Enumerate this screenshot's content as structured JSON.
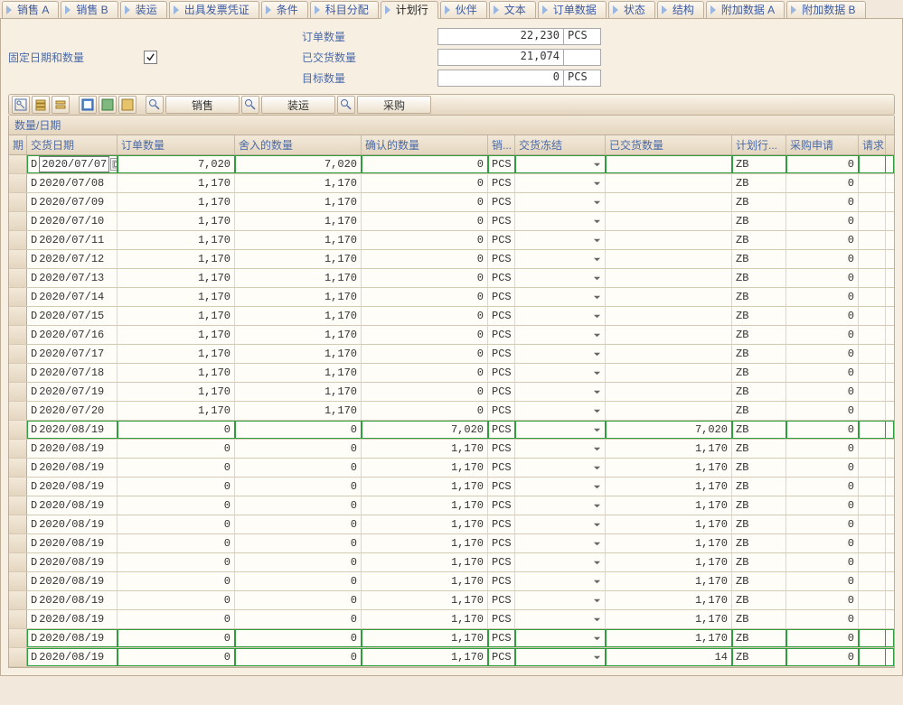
{
  "tabs": [
    "销售 A",
    "销售 B",
    "装运",
    "出具发票凭证",
    "条件",
    "科目分配",
    "计划行",
    "伙伴",
    "文本",
    "订单数据",
    "状态",
    "结构",
    "附加数据 A",
    "附加数据 B"
  ],
  "active_tab_index": 6,
  "form": {
    "fixed_date_qty_label": "固定日期和数量",
    "fixed_date_qty_checked": true,
    "rows": [
      {
        "label": "订单数量",
        "value": "22,230",
        "unit": "PCS"
      },
      {
        "label": "已交货数量",
        "value": "21,074",
        "unit": ""
      },
      {
        "label": "目标数量",
        "value": "0",
        "unit": "PCS"
      }
    ]
  },
  "toolbar": {
    "btn_sales": "销售",
    "btn_shipping": "装运",
    "btn_purchase": "采购"
  },
  "table": {
    "title": "数量/日期",
    "columns": [
      "期",
      "交货日期",
      "订单数量",
      "舍入的数量",
      "确认的数量",
      "销...",
      "交货冻结",
      "已交货数量",
      "计划行...",
      "采购申请",
      "请求..."
    ],
    "rows": [
      {
        "p": "D",
        "date": "2020/07/07",
        "oq": "7,020",
        "rq": "7,020",
        "cq": "0",
        "u": "PCS",
        "dq": "",
        "sl": "ZB",
        "pr": "0",
        "hi": true,
        "sel": true
      },
      {
        "p": "D",
        "date": "2020/07/08",
        "oq": "1,170",
        "rq": "1,170",
        "cq": "0",
        "u": "PCS",
        "dq": "",
        "sl": "ZB",
        "pr": "0"
      },
      {
        "p": "D",
        "date": "2020/07/09",
        "oq": "1,170",
        "rq": "1,170",
        "cq": "0",
        "u": "PCS",
        "dq": "",
        "sl": "ZB",
        "pr": "0"
      },
      {
        "p": "D",
        "date": "2020/07/10",
        "oq": "1,170",
        "rq": "1,170",
        "cq": "0",
        "u": "PCS",
        "dq": "",
        "sl": "ZB",
        "pr": "0"
      },
      {
        "p": "D",
        "date": "2020/07/11",
        "oq": "1,170",
        "rq": "1,170",
        "cq": "0",
        "u": "PCS",
        "dq": "",
        "sl": "ZB",
        "pr": "0"
      },
      {
        "p": "D",
        "date": "2020/07/12",
        "oq": "1,170",
        "rq": "1,170",
        "cq": "0",
        "u": "PCS",
        "dq": "",
        "sl": "ZB",
        "pr": "0"
      },
      {
        "p": "D",
        "date": "2020/07/13",
        "oq": "1,170",
        "rq": "1,170",
        "cq": "0",
        "u": "PCS",
        "dq": "",
        "sl": "ZB",
        "pr": "0"
      },
      {
        "p": "D",
        "date": "2020/07/14",
        "oq": "1,170",
        "rq": "1,170",
        "cq": "0",
        "u": "PCS",
        "dq": "",
        "sl": "ZB",
        "pr": "0"
      },
      {
        "p": "D",
        "date": "2020/07/15",
        "oq": "1,170",
        "rq": "1,170",
        "cq": "0",
        "u": "PCS",
        "dq": "",
        "sl": "ZB",
        "pr": "0"
      },
      {
        "p": "D",
        "date": "2020/07/16",
        "oq": "1,170",
        "rq": "1,170",
        "cq": "0",
        "u": "PCS",
        "dq": "",
        "sl": "ZB",
        "pr": "0"
      },
      {
        "p": "D",
        "date": "2020/07/17",
        "oq": "1,170",
        "rq": "1,170",
        "cq": "0",
        "u": "PCS",
        "dq": "",
        "sl": "ZB",
        "pr": "0"
      },
      {
        "p": "D",
        "date": "2020/07/18",
        "oq": "1,170",
        "rq": "1,170",
        "cq": "0",
        "u": "PCS",
        "dq": "",
        "sl": "ZB",
        "pr": "0"
      },
      {
        "p": "D",
        "date": "2020/07/19",
        "oq": "1,170",
        "rq": "1,170",
        "cq": "0",
        "u": "PCS",
        "dq": "",
        "sl": "ZB",
        "pr": "0"
      },
      {
        "p": "D",
        "date": "2020/07/20",
        "oq": "1,170",
        "rq": "1,170",
        "cq": "0",
        "u": "PCS",
        "dq": "",
        "sl": "ZB",
        "pr": "0"
      },
      {
        "p": "D",
        "date": "2020/08/19",
        "oq": "0",
        "rq": "0",
        "cq": "7,020",
        "u": "PCS",
        "dq": "7,020",
        "sl": "ZB",
        "pr": "0",
        "hi": true
      },
      {
        "p": "D",
        "date": "2020/08/19",
        "oq": "0",
        "rq": "0",
        "cq": "1,170",
        "u": "PCS",
        "dq": "1,170",
        "sl": "ZB",
        "pr": "0"
      },
      {
        "p": "D",
        "date": "2020/08/19",
        "oq": "0",
        "rq": "0",
        "cq": "1,170",
        "u": "PCS",
        "dq": "1,170",
        "sl": "ZB",
        "pr": "0"
      },
      {
        "p": "D",
        "date": "2020/08/19",
        "oq": "0",
        "rq": "0",
        "cq": "1,170",
        "u": "PCS",
        "dq": "1,170",
        "sl": "ZB",
        "pr": "0"
      },
      {
        "p": "D",
        "date": "2020/08/19",
        "oq": "0",
        "rq": "0",
        "cq": "1,170",
        "u": "PCS",
        "dq": "1,170",
        "sl": "ZB",
        "pr": "0"
      },
      {
        "p": "D",
        "date": "2020/08/19",
        "oq": "0",
        "rq": "0",
        "cq": "1,170",
        "u": "PCS",
        "dq": "1,170",
        "sl": "ZB",
        "pr": "0"
      },
      {
        "p": "D",
        "date": "2020/08/19",
        "oq": "0",
        "rq": "0",
        "cq": "1,170",
        "u": "PCS",
        "dq": "1,170",
        "sl": "ZB",
        "pr": "0"
      },
      {
        "p": "D",
        "date": "2020/08/19",
        "oq": "0",
        "rq": "0",
        "cq": "1,170",
        "u": "PCS",
        "dq": "1,170",
        "sl": "ZB",
        "pr": "0"
      },
      {
        "p": "D",
        "date": "2020/08/19",
        "oq": "0",
        "rq": "0",
        "cq": "1,170",
        "u": "PCS",
        "dq": "1,170",
        "sl": "ZB",
        "pr": "0"
      },
      {
        "p": "D",
        "date": "2020/08/19",
        "oq": "0",
        "rq": "0",
        "cq": "1,170",
        "u": "PCS",
        "dq": "1,170",
        "sl": "ZB",
        "pr": "0"
      },
      {
        "p": "D",
        "date": "2020/08/19",
        "oq": "0",
        "rq": "0",
        "cq": "1,170",
        "u": "PCS",
        "dq": "1,170",
        "sl": "ZB",
        "pr": "0"
      },
      {
        "p": "D",
        "date": "2020/08/19",
        "oq": "0",
        "rq": "0",
        "cq": "1,170",
        "u": "PCS",
        "dq": "1,170",
        "sl": "ZB",
        "pr": "0",
        "hi": true
      },
      {
        "p": "D",
        "date": "2020/08/19",
        "oq": "0",
        "rq": "0",
        "cq": "1,170",
        "u": "PCS",
        "dq": "14",
        "sl": "ZB",
        "pr": "0",
        "hi": true
      }
    ]
  }
}
